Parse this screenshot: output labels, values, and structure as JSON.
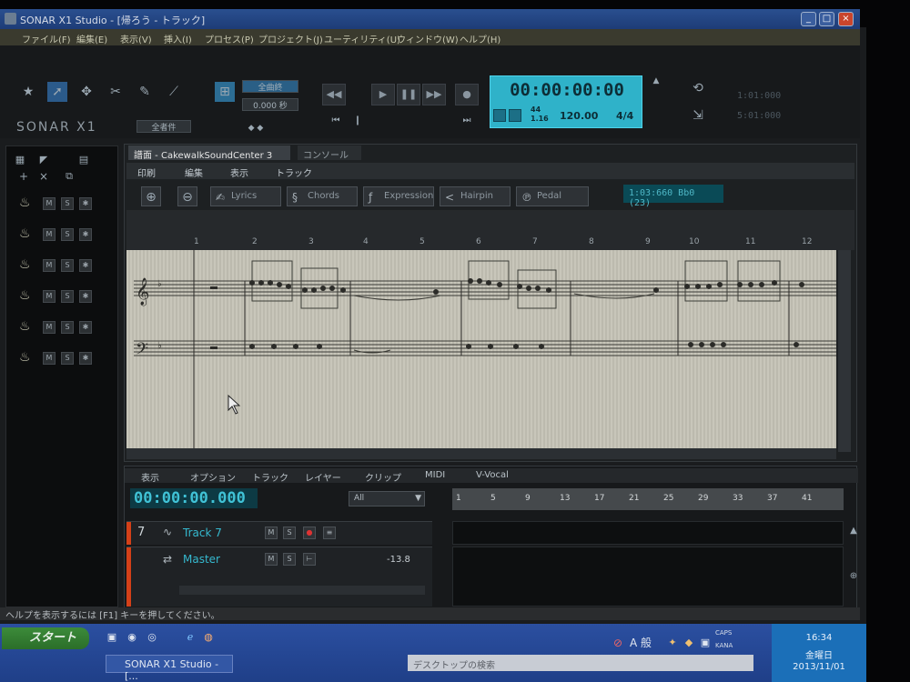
{
  "window": {
    "title": "SONAR X1 Studio - [帰ろう - トラック]"
  },
  "menubar": [
    "ファイル(F)",
    "編集(E)",
    "表示(V)",
    "挿入(I)",
    "プロセス(P)",
    "プロジェクト(J)",
    "ユーティリティ(U)",
    "ウィンドウ(W)",
    "ヘルプ(H)"
  ],
  "controlbar": {
    "logo": "SONAR X1",
    "preset": "全者件",
    "nudge_top": "全曲終",
    "nudge_value": "0.000 秒",
    "clock": "00:00:00:00",
    "meter_top": "44",
    "meter_bottom": "1.16",
    "tempo": "120.00",
    "time_sig": "4/4",
    "loop_start": "1:01:000",
    "loop_end": "5:01:000"
  },
  "staffview": {
    "tabs": [
      "譜面 - CakewalkSoundCenter 3",
      "コンソール"
    ],
    "menu": [
      "印刷",
      "編集",
      "表示",
      "トラック"
    ],
    "tools": [
      "Lyrics",
      "Chords",
      "Expression",
      "Hairpin",
      "Pedal"
    ],
    "position": "1:03:660  Bb0 (23)",
    "ruler_ticks": [
      "1",
      "2",
      "3",
      "4",
      "5",
      "6",
      "7",
      "8",
      "9",
      "10",
      "11",
      "12"
    ]
  },
  "trackview": {
    "menu": [
      "表示",
      "オプション",
      "トラック",
      "レイヤー",
      "クリップ",
      "MIDI",
      "V-Vocal"
    ],
    "clock": "00:00:00.000",
    "filter": "All",
    "ruler": [
      "1",
      "5",
      "9",
      "13",
      "17",
      "21",
      "25",
      "29",
      "33",
      "37",
      "41"
    ],
    "tracks": [
      {
        "number": "7",
        "name": "Track 7",
        "value": ""
      },
      {
        "number": "",
        "name": "Master",
        "value": "-13.8"
      }
    ]
  },
  "statusbar": {
    "text": "ヘルプを表示するには [F1] キーを押してください。"
  },
  "taskbar": {
    "start": "スタート",
    "task": "SONAR X1 Studio - [...",
    "deskbar": "デスクトップの検索",
    "ime": "A 般",
    "time": "16:34",
    "day": "金曜日",
    "date": "2013/11/01",
    "caps": "CAPS",
    "kana": "KANA"
  }
}
